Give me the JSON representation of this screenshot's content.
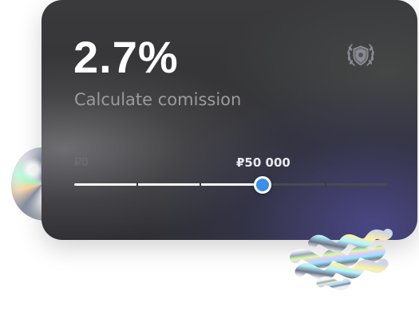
{
  "card": {
    "rate": "2.7%",
    "subtitle": "Calculate comission"
  },
  "badge": {
    "icon": "shield-laurel-icon"
  },
  "slider": {
    "min_label": "₽0",
    "value_label": "₽50 000",
    "fill_fraction": 0.6,
    "tick_fractions": [
      0.2,
      0.4,
      0.6,
      0.8
    ],
    "accent_color": "#3d8ee6"
  },
  "decor": {
    "orb": "holographic-orb",
    "spring": "holographic-spring"
  }
}
